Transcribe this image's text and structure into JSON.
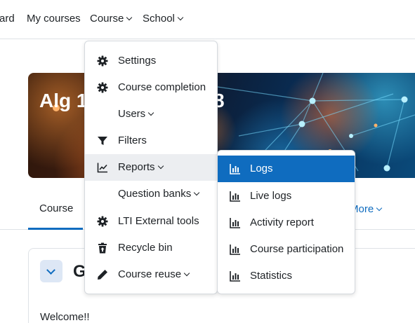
{
  "topnav": {
    "items": [
      {
        "label": "ard",
        "has_dropdown": false
      },
      {
        "label": "My courses",
        "has_dropdown": false
      },
      {
        "label": "Course",
        "has_dropdown": true
      },
      {
        "label": "School",
        "has_dropdown": true
      }
    ]
  },
  "hero": {
    "title_start": "Alg 1",
    "title_end": "8"
  },
  "tabs": {
    "active": "Course",
    "more": "More"
  },
  "section": {
    "title": "G",
    "welcome": "Welcome!!"
  },
  "course_menu": {
    "items": [
      {
        "label": "Settings",
        "icon": "gear-icon",
        "has_dropdown": false
      },
      {
        "label": "Course completion",
        "icon": "gear-icon",
        "has_dropdown": false
      },
      {
        "label": "Users",
        "icon": "",
        "has_dropdown": true
      },
      {
        "label": "Filters",
        "icon": "filter-icon",
        "has_dropdown": false
      },
      {
        "label": "Reports",
        "icon": "chart-line-icon",
        "has_dropdown": true,
        "highlighted": true
      },
      {
        "label": "Question banks",
        "icon": "",
        "has_dropdown": true
      },
      {
        "label": "LTI External tools",
        "icon": "gear-icon",
        "has_dropdown": false
      },
      {
        "label": "Recycle bin",
        "icon": "trash-restore-icon",
        "has_dropdown": false
      },
      {
        "label": "Course reuse",
        "icon": "pencil-icon",
        "has_dropdown": true
      }
    ]
  },
  "reports_submenu": {
    "items": [
      {
        "label": "Logs",
        "icon": "bar-chart-icon",
        "active": true
      },
      {
        "label": "Live logs",
        "icon": "bar-chart-icon",
        "active": false
      },
      {
        "label": "Activity report",
        "icon": "bar-chart-icon",
        "active": false
      },
      {
        "label": "Course participation",
        "icon": "bar-chart-icon",
        "active": false
      },
      {
        "label": "Statistics",
        "icon": "bar-chart-icon",
        "active": false
      }
    ]
  },
  "colors": {
    "accent": "#0f6cbf",
    "text": "#1d2125",
    "hover": "#eceef1",
    "border": "#dee2e6"
  }
}
